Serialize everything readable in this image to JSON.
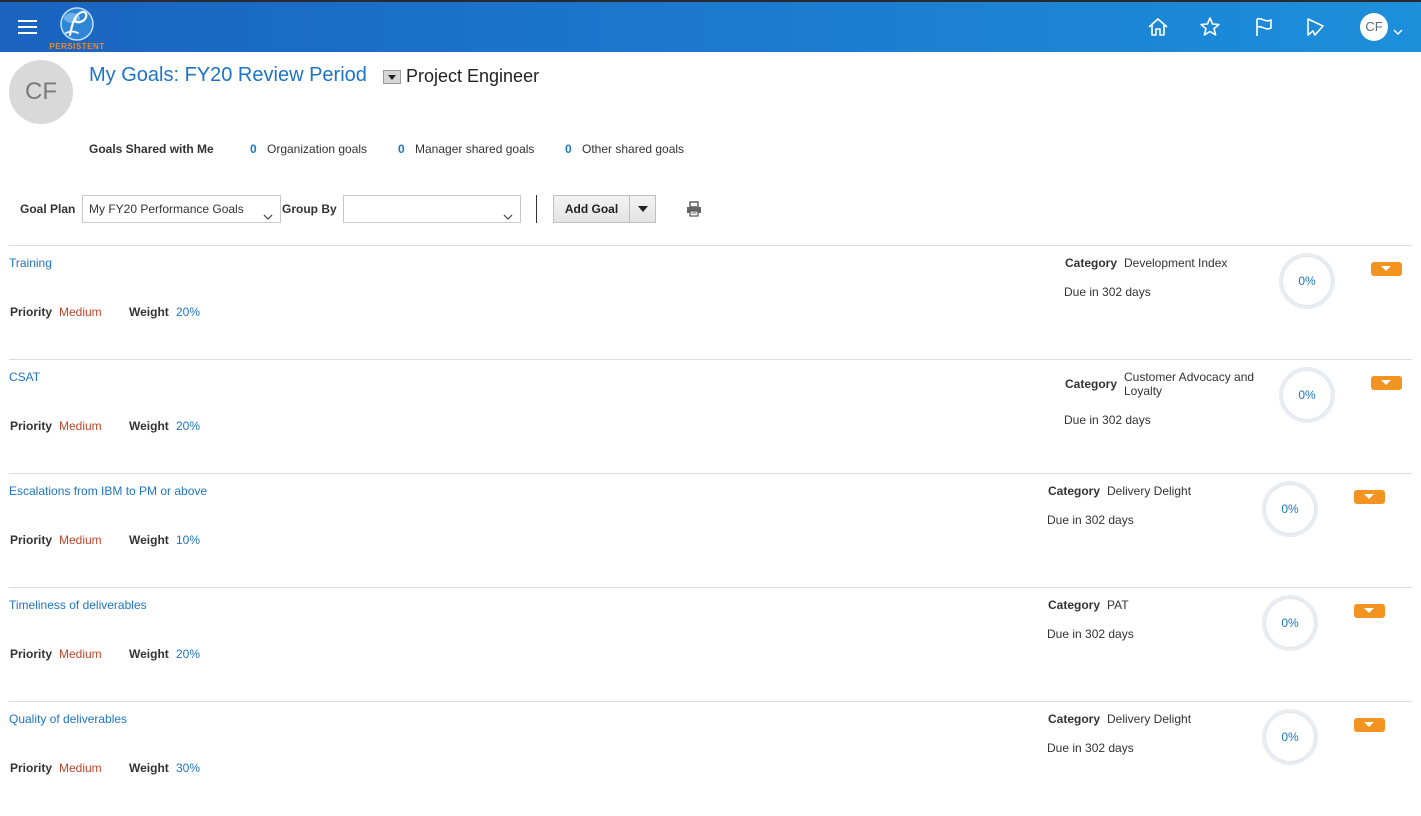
{
  "app": {
    "logo_text": "PERSISTENT",
    "user_initials": "CF",
    "nav_icons": [
      "home-icon",
      "star-icon",
      "flag-icon",
      "notifications-icon"
    ],
    "colors": {
      "topbar": "#1b7bd0",
      "link": "#1d74c5",
      "priority": "#c0462a",
      "action": "#f39321"
    }
  },
  "header": {
    "avatar_initials": "CF",
    "title": "My Goals: FY20 Review Period",
    "role": "Project Engineer"
  },
  "shared": {
    "label": "Goals Shared with Me",
    "org_count": "0",
    "org_label": "Organization goals",
    "mgr_count": "0",
    "mgr_label": "Manager shared goals",
    "other_count": "0",
    "other_label": "Other shared goals"
  },
  "toolbar": {
    "goal_plan_label": "Goal Plan",
    "goal_plan_value": "My FY20 Performance Goals",
    "group_by_label": "Group By",
    "group_by_value": "",
    "add_goal_label": "Add Goal"
  },
  "goals": [
    {
      "name": "Training",
      "priority_label": "Priority",
      "priority": "Medium",
      "weight_label": "Weight",
      "weight": "20%",
      "category_label": "Category",
      "category": "Development Index",
      "due": "Due in 302 days",
      "progress": "0%"
    },
    {
      "name": "CSAT",
      "priority_label": "Priority",
      "priority": "Medium",
      "weight_label": "Weight",
      "weight": "20%",
      "category_label": "Category",
      "category": "Customer Advocacy and Loyalty",
      "due": "Due in 302 days",
      "progress": "0%"
    },
    {
      "name": "Escalations from IBM to PM or above",
      "priority_label": "Priority",
      "priority": "Medium",
      "weight_label": "Weight",
      "weight": "10%",
      "category_label": "Category",
      "category": "Delivery Delight",
      "due": "Due in 302 days",
      "progress": "0%"
    },
    {
      "name": "Timeliness of deliverables",
      "priority_label": "Priority",
      "priority": "Medium",
      "weight_label": "Weight",
      "weight": "20%",
      "category_label": "Category",
      "category": "PAT",
      "due": "Due in 302 days",
      "progress": "0%"
    },
    {
      "name": "Quality of deliverables",
      "priority_label": "Priority",
      "priority": "Medium",
      "weight_label": "Weight",
      "weight": "30%",
      "category_label": "Category",
      "category": "Delivery Delight",
      "due": "Due in 302 days",
      "progress": "0%"
    }
  ]
}
